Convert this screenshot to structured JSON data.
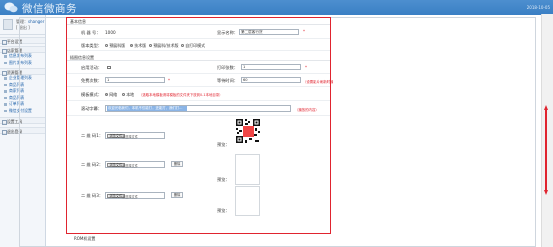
{
  "app": {
    "title": "微信微商务",
    "date": "2018-10-05"
  },
  "user": {
    "label": "管理：",
    "name": "shanger",
    "action": "[ 退出 ]"
  },
  "sidebar": {
    "sections": [
      {
        "title": "平台设置",
        "items": []
      },
      {
        "title": "店家管理",
        "items": [
          "信息发布列表",
          "图片发布列表"
        ]
      },
      {
        "title": "资源管理",
        "items": [
          "企业管理列表",
          "商品列表",
          "商家列表",
          "商品列表",
          "订单列表",
          "微信支付设置"
        ]
      },
      {
        "title": "设置工具",
        "items": []
      },
      {
        "title": "退出登录",
        "items": []
      }
    ]
  },
  "panel": {
    "basic_title": "基本信息",
    "machine_no_label": "机 器 号：",
    "machine_no_value": "1000",
    "display_name_label": "显示名称：",
    "display_name_value": "第二层客行货",
    "type_label": "版本类型：",
    "type_options": [
      "预展科版",
      "技术版",
      "预展科/技术版",
      "自打印模式"
    ],
    "type_selected": 1,
    "fun_title": "插图信息设置",
    "enable_label": "启用活动：",
    "print_count_label": "打印张数：",
    "print_count_value": "1",
    "free_count_label": "免费次数：",
    "free_count_value": "1",
    "wait_label": "等待时间：",
    "wait_value": "60",
    "wait_note": "（设置影片刷新时播放默认频次时间）",
    "template_label": "模板模式：",
    "template_options": [
      "网络",
      "本地"
    ],
    "template_selected": 0,
    "template_note": "（选取本地模板请将模板的文件夹下放到0-1本地目录）",
    "scroll_label": "滚动字幕：",
    "scroll_value": "欢迎光临我们，本机不仅能打，还能打，我们打...",
    "scroll_note": "（播放的内容）",
    "qr1_label": "二 维 码1：",
    "qr2_label": "二 维 码2：",
    "qr3_label": "二 维 码3：",
    "file_button": "浏览文件",
    "file_placeholder": "未选择文件",
    "delete_button": "删除",
    "preview_label": "预览：",
    "required_mark": "*"
  },
  "bottom": {
    "section_title": "ROM机设置"
  }
}
